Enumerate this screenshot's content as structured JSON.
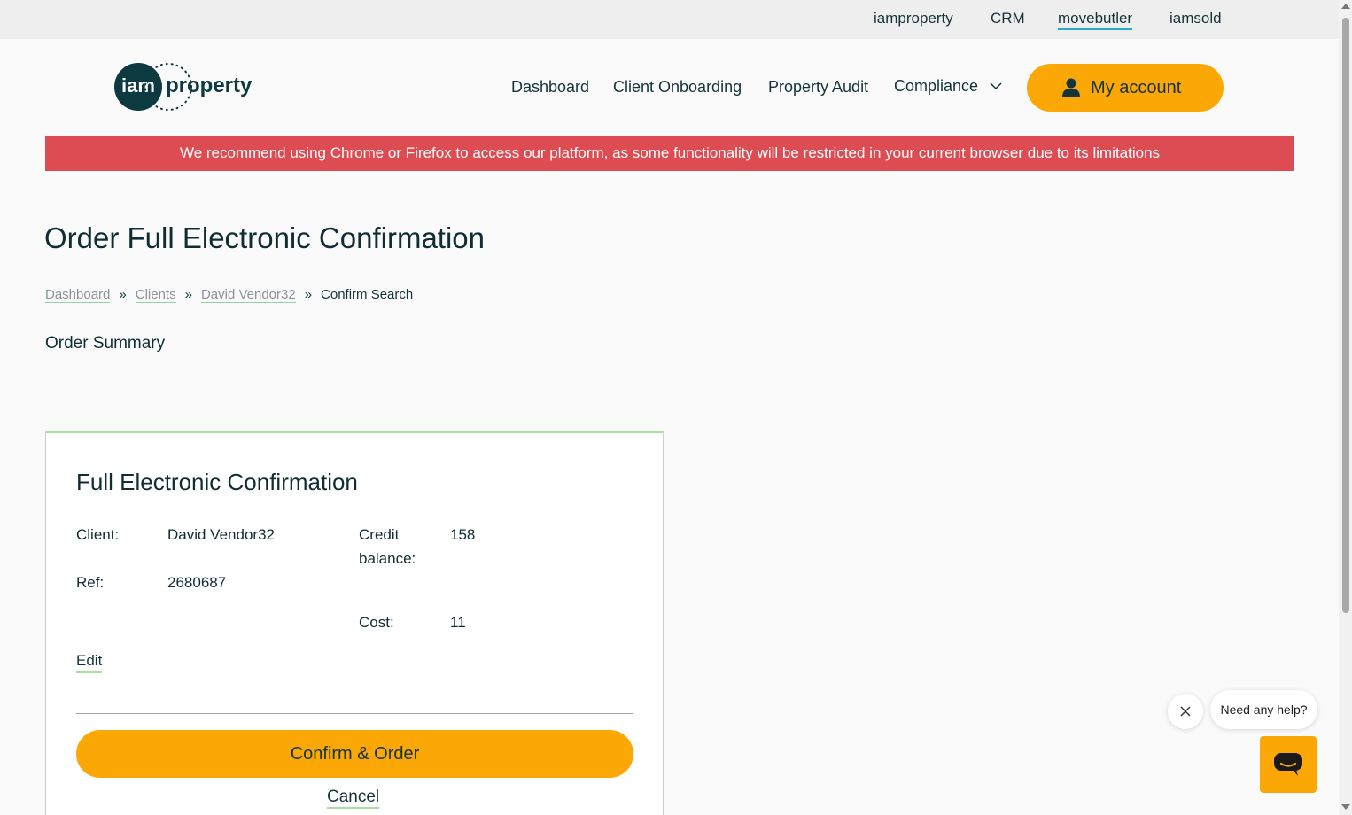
{
  "topbar": {
    "links": [
      "iamproperty",
      "CRM",
      "movebutler",
      "iamsold"
    ],
    "active": "movebutler"
  },
  "logo": {
    "mark": "iam",
    "text": "property"
  },
  "nav": {
    "items": [
      "Dashboard",
      "Client Onboarding",
      "Property Audit",
      "Compliance"
    ],
    "account_label": "My account"
  },
  "banner": {
    "text": "We recommend using Chrome or Firefox to access our platform, as some functionality will be restricted in your current browser due to its limitations"
  },
  "page": {
    "title": "Order Full Electronic Confirmation",
    "breadcrumb": [
      "Dashboard",
      "Clients",
      "David Vendor32",
      "Confirm Search"
    ],
    "breadcrumb_sep": "»",
    "section_title": "Order Summary"
  },
  "card": {
    "title": "Full Electronic Confirmation",
    "client_label": "Client:",
    "client_value": "David Vendor32",
    "ref_label": "Ref:",
    "ref_value": "2680687",
    "credit_label": "Credit balance:",
    "credit_value": "158",
    "cost_label": "Cost:",
    "cost_value": "11",
    "edit_label": "Edit",
    "confirm_label": "Confirm & Order",
    "cancel_label": "Cancel"
  },
  "help": {
    "bubble_text": "Need any help?"
  },
  "colors": {
    "accent": "#fba705",
    "banner": "#dc4c52",
    "text": "#0f2d33",
    "link_underline": "#a9dca0"
  }
}
